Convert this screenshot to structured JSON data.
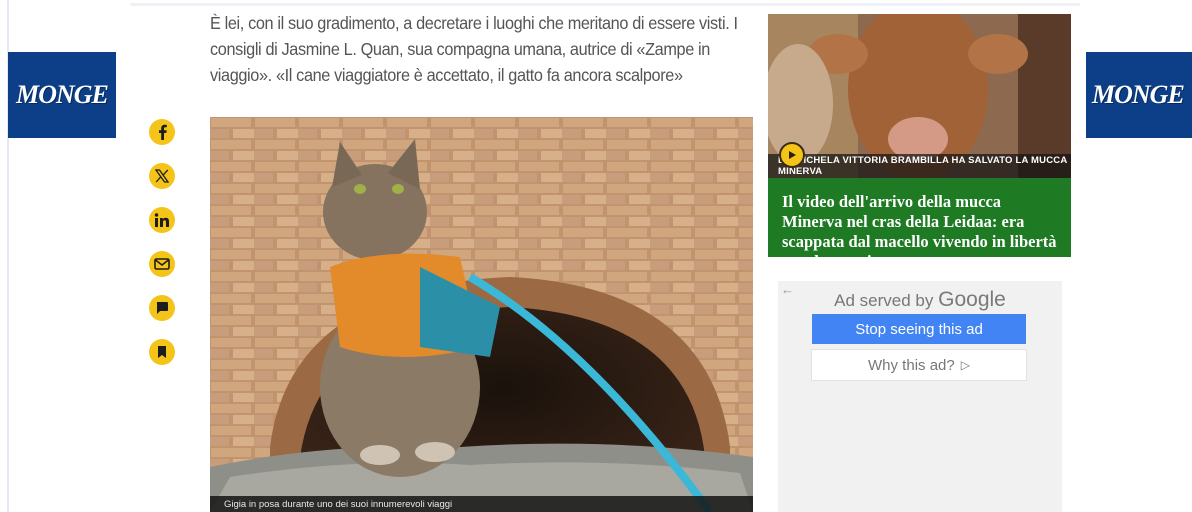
{
  "article": {
    "lead": "È lei, con il suo gradimento, a decretare i luoghi che meritano di essere visti. I consigli di Jasmine L. Quan, sua compagna umana, autrice di «Zampe in viaggio». «Il cane viaggiatore è accettato, il gatto fa ancora scalpore»",
    "photo_caption": "Gigia in posa durante uno dei suoi innumerevoli viaggi"
  },
  "share": [
    {
      "name": "facebook",
      "icon": "facebook-icon"
    },
    {
      "name": "x",
      "icon": "x-icon"
    },
    {
      "name": "linkedin",
      "icon": "linkedin-icon"
    },
    {
      "name": "email",
      "icon": "mail-icon"
    },
    {
      "name": "comments",
      "icon": "comment-icon"
    },
    {
      "name": "bookmark",
      "icon": "bookmark-icon"
    }
  ],
  "side_ads": {
    "left_brand": "MONGE",
    "right_brand": "MONGE"
  },
  "video": {
    "strip_text": "L... MICHELA VITTORIA BRAMBILLA HA SALVATO LA MUCCA MINERVA",
    "title": "Il video dell'arrivo della mucca Minerva nel cras della Leidaa: era scappata dal macello vivendo in libertà per due mesi"
  },
  "google_ad": {
    "label_prefix": "Ad served by",
    "label_brand": "Google",
    "back_glyph": "←",
    "stop_label": "Stop seeing this ad",
    "why_label": "Why this ad?",
    "why_glyph": "▷"
  },
  "colors": {
    "accent_yellow": "#f4c418",
    "monge_blue": "#0c3f88",
    "video_green": "#1f7a24",
    "google_blue": "#4284f3"
  }
}
